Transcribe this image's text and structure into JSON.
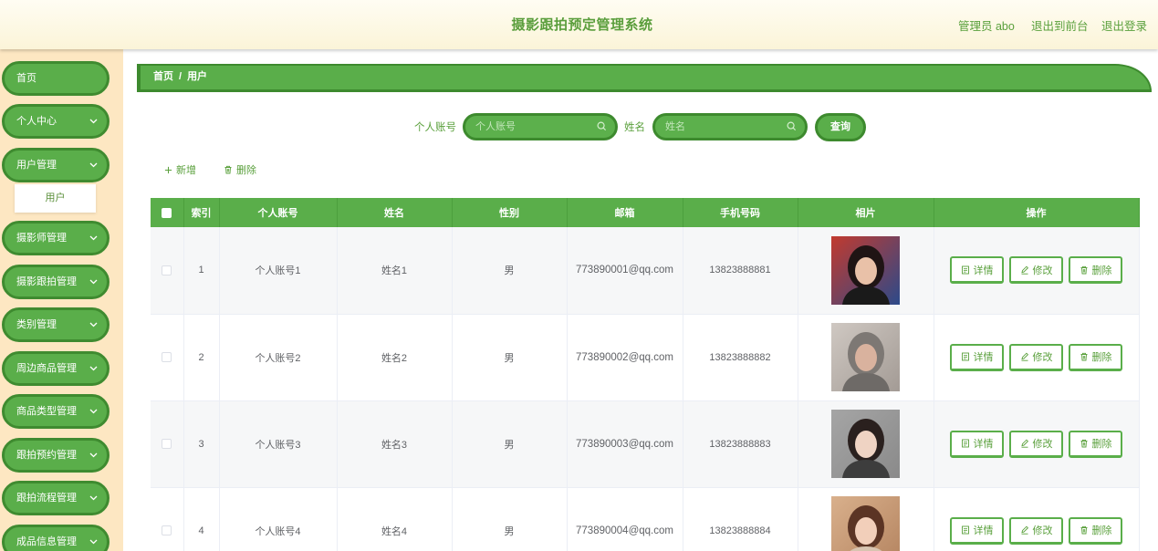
{
  "header": {
    "title": "摄影跟拍预定管理系统",
    "user": "管理员 abo",
    "to_front": "退出到前台",
    "logout": "退出登录"
  },
  "sidebar": {
    "items": [
      {
        "label": "首页",
        "expandable": false
      },
      {
        "label": "个人中心",
        "expandable": true
      },
      {
        "label": "用户管理",
        "expandable": true,
        "expanded": true,
        "children": [
          "用户"
        ]
      },
      {
        "label": "摄影师管理",
        "expandable": true
      },
      {
        "label": "摄影跟拍管理",
        "expandable": true
      },
      {
        "label": "类别管理",
        "expandable": true
      },
      {
        "label": "周边商品管理",
        "expandable": true
      },
      {
        "label": "商品类型管理",
        "expandable": true
      },
      {
        "label": "跟拍预约管理",
        "expandable": true
      },
      {
        "label": "跟拍流程管理",
        "expandable": true
      },
      {
        "label": "成品信息管理",
        "expandable": true
      }
    ]
  },
  "breadcrumb": {
    "home": "首页",
    "separator": "/",
    "current": "用户"
  },
  "search": {
    "account_label": "个人账号",
    "account_placeholder": "个人账号",
    "name_label": "姓名",
    "name_placeholder": "姓名",
    "query_button": "查询"
  },
  "actions": {
    "add": "新增",
    "delete": "删除"
  },
  "table": {
    "columns": [
      "索引",
      "个人账号",
      "姓名",
      "性别",
      "邮箱",
      "手机号码",
      "相片",
      "操作"
    ],
    "row_actions": [
      "详情",
      "修改",
      "删除"
    ],
    "rows": [
      {
        "index": "1",
        "account": "个人账号1",
        "name": "姓名1",
        "gender": "男",
        "email": "773890001@qq.com",
        "phone": "13823888881"
      },
      {
        "index": "2",
        "account": "个人账号2",
        "name": "姓名2",
        "gender": "男",
        "email": "773890002@qq.com",
        "phone": "13823888882"
      },
      {
        "index": "3",
        "account": "个人账号3",
        "name": "姓名3",
        "gender": "男",
        "email": "773890003@qq.com",
        "phone": "13823888883"
      },
      {
        "index": "4",
        "account": "个人账号4",
        "name": "姓名4",
        "gender": "男",
        "email": "773890004@qq.com",
        "phone": "13823888884"
      }
    ]
  },
  "icons": [
    "chevron-down-icon",
    "search-icon",
    "plus-icon",
    "trash-icon",
    "detail-icon",
    "edit-icon"
  ],
  "colors": {
    "primary": "#5aae4a",
    "primary_dark": "#3f8b30",
    "text_green": "#5aa03c",
    "header_bg": "#fdf8e3",
    "sidebar_bg": "#fde7c2"
  }
}
